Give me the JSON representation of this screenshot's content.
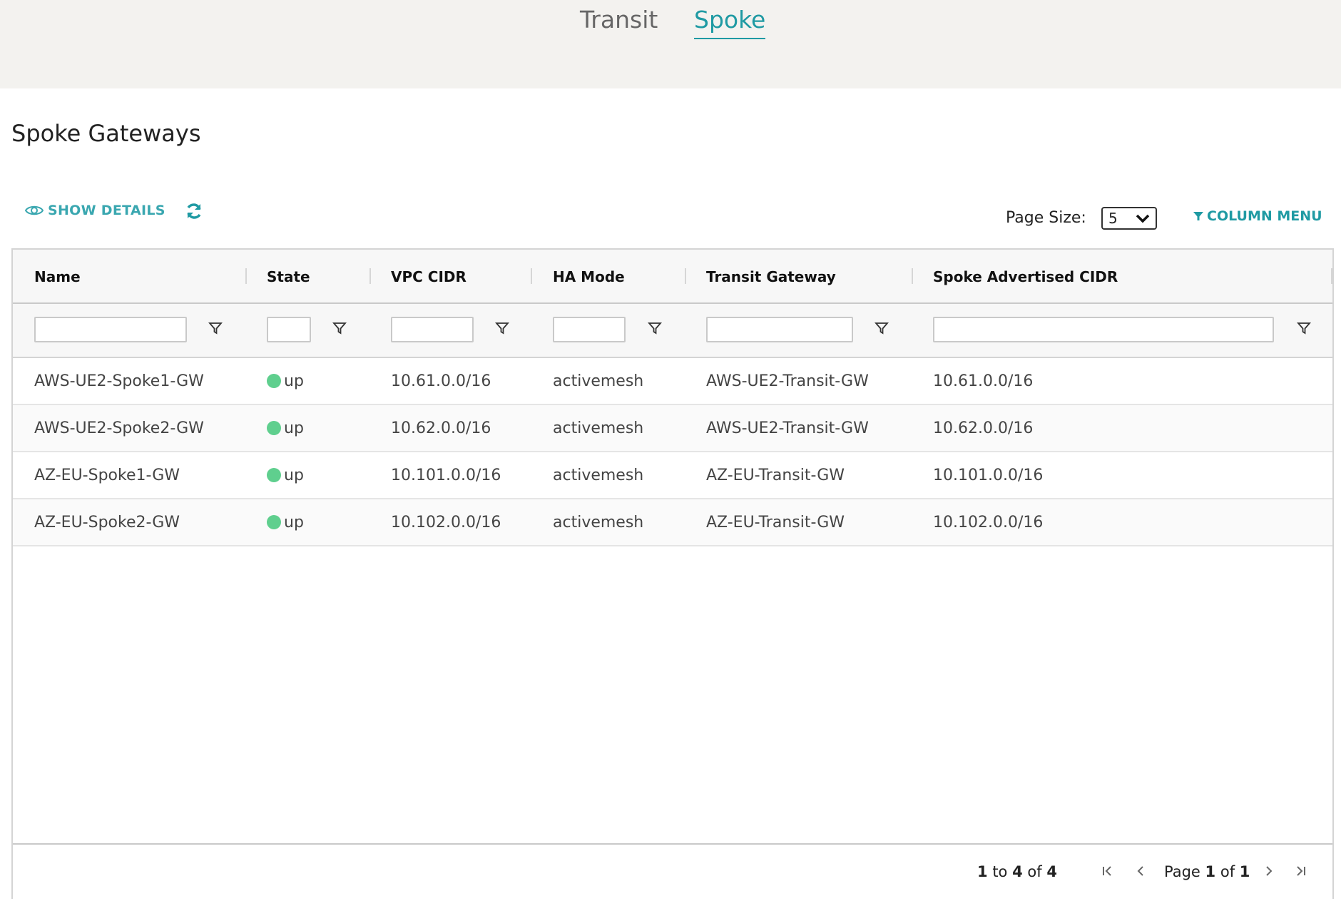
{
  "tabs": {
    "transit": "Transit",
    "spoke": "Spoke"
  },
  "page_title": "Spoke Gateways",
  "toolbar": {
    "show_details": "SHOW DETAILS",
    "page_size_label": "Page Size:",
    "page_size_value": "5",
    "column_menu": "COLUMN MENU"
  },
  "columns": {
    "name": "Name",
    "state": "State",
    "vpc_cidr": "VPC CIDR",
    "ha_mode": "HA Mode",
    "transit_gateway": "Transit Gateway",
    "spoke_advertised_cidr": "Spoke Advertised CIDR"
  },
  "rows": [
    {
      "name": "AWS-UE2-Spoke1-GW",
      "state": "up",
      "vpc_cidr": "10.61.0.0/16",
      "ha_mode": "activemesh",
      "transit_gateway": "AWS-UE2-Transit-GW",
      "spoke_advertised_cidr": "10.61.0.0/16"
    },
    {
      "name": "AWS-UE2-Spoke2-GW",
      "state": "up",
      "vpc_cidr": "10.62.0.0/16",
      "ha_mode": "activemesh",
      "transit_gateway": "AWS-UE2-Transit-GW",
      "spoke_advertised_cidr": "10.62.0.0/16"
    },
    {
      "name": "AZ-EU-Spoke1-GW",
      "state": "up",
      "vpc_cidr": "10.101.0.0/16",
      "ha_mode": "activemesh",
      "transit_gateway": "AZ-EU-Transit-GW",
      "spoke_advertised_cidr": "10.101.0.0/16"
    },
    {
      "name": "AZ-EU-Spoke2-GW",
      "state": "up",
      "vpc_cidr": "10.102.0.0/16",
      "ha_mode": "activemesh",
      "transit_gateway": "AZ-EU-Transit-GW",
      "spoke_advertised_cidr": "10.102.0.0/16"
    }
  ],
  "footer": {
    "range_start": "1",
    "range_to": "to",
    "range_end": "4",
    "range_of": "of",
    "total": "4",
    "page_label": "Page",
    "page_current": "1",
    "page_of": "of",
    "page_total": "1"
  },
  "colors": {
    "accent": "#1f9aa3",
    "status_up": "#5fcf8e"
  }
}
